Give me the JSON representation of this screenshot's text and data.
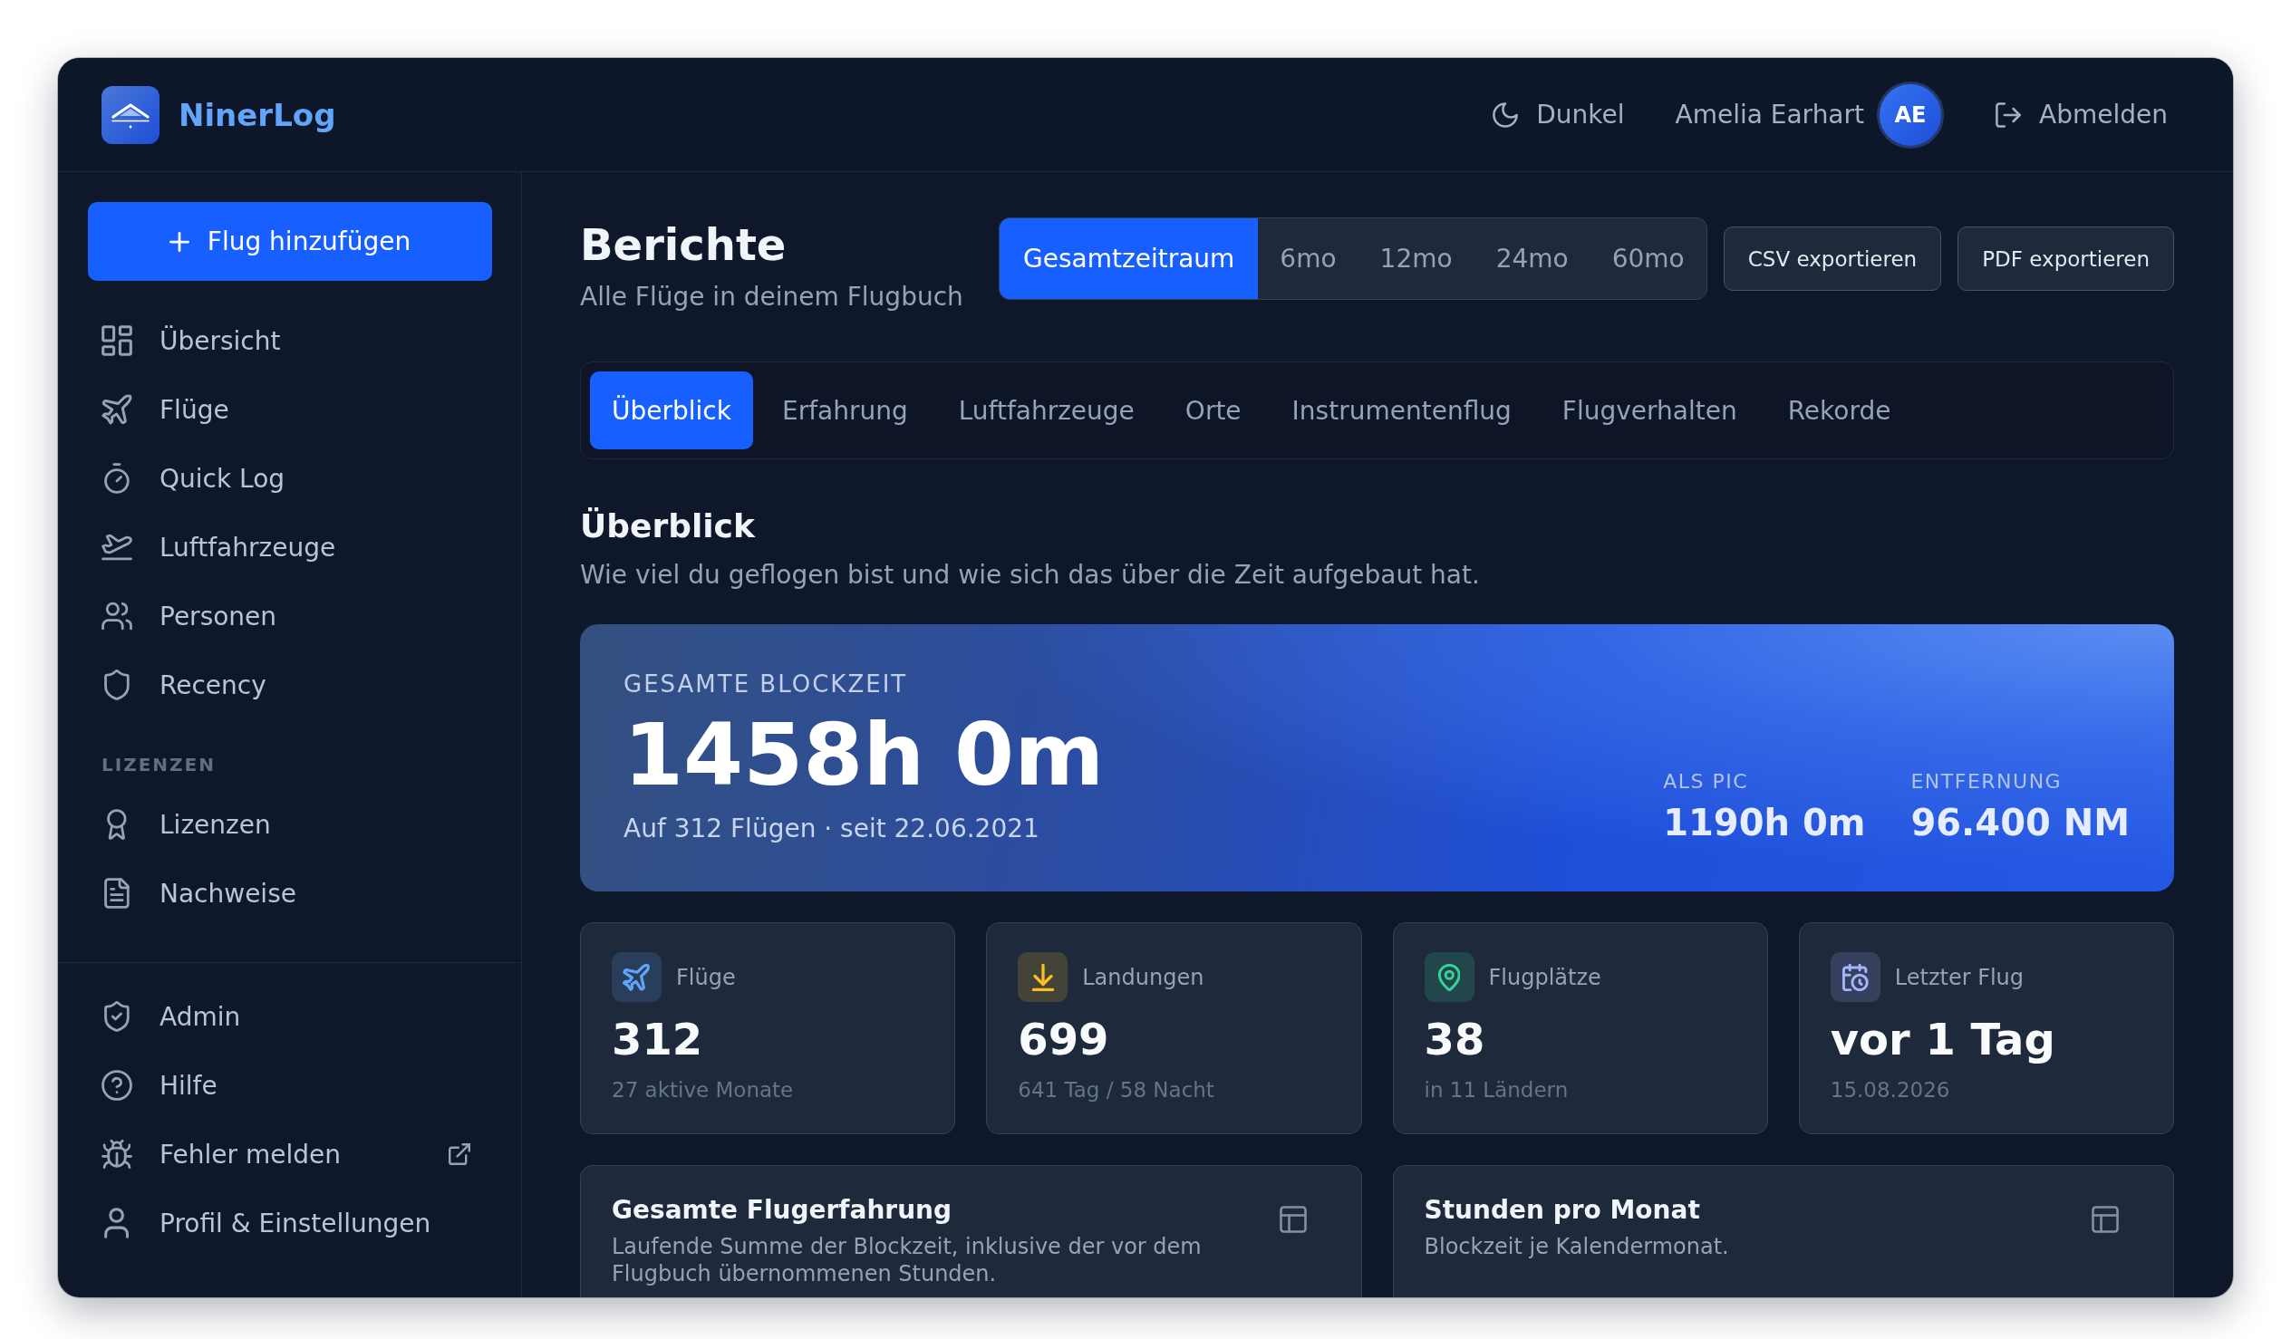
{
  "app": {
    "name": "NinerLog"
  },
  "header": {
    "theme_toggle": "Dunkel",
    "user_name": "Amelia Earhart",
    "user_initials": "AE",
    "logout": "Abmelden"
  },
  "sidebar": {
    "add_button": "Flug hinzufügen",
    "items": [
      {
        "kind": "overview",
        "label": "Übersicht",
        "external": false
      },
      {
        "kind": "flights",
        "label": "Flüge",
        "external": false
      },
      {
        "kind": "quicklog",
        "label": "Quick Log",
        "external": false
      },
      {
        "kind": "aircraft",
        "label": "Luftfahrzeuge",
        "external": false
      },
      {
        "kind": "people",
        "label": "Personen",
        "external": false
      },
      {
        "kind": "recency",
        "label": "Recency",
        "external": false
      }
    ],
    "sections": [
      {
        "heading": "LIZENZEN",
        "items": [
          {
            "kind": "licenses",
            "label": "Lizenzen",
            "external": false
          },
          {
            "kind": "documents",
            "label": "Nachweise",
            "external": false
          }
        ]
      }
    ],
    "footer_items": [
      {
        "kind": "admin",
        "label": "Admin",
        "external": false
      },
      {
        "kind": "help",
        "label": "Hilfe",
        "external": false
      },
      {
        "kind": "bug",
        "label": "Fehler melden",
        "external": true
      },
      {
        "kind": "profile",
        "label": "Profil & Einstellungen",
        "external": false
      }
    ]
  },
  "page": {
    "title": "Berichte",
    "subtitle": "Alle Flüge in deinem Flugbuch",
    "ranges": [
      {
        "label": "Gesamtzeitraum",
        "selected": true
      },
      {
        "label": "6mo",
        "selected": false
      },
      {
        "label": "12mo",
        "selected": false
      },
      {
        "label": "24mo",
        "selected": false
      },
      {
        "label": "60mo",
        "selected": false
      }
    ],
    "export_buttons": [
      "CSV exportieren",
      "PDF exportieren"
    ]
  },
  "tabs": [
    {
      "label": "Überblick",
      "selected": true
    },
    {
      "label": "Erfahrung",
      "selected": false
    },
    {
      "label": "Luftfahrzeuge",
      "selected": false
    },
    {
      "label": "Orte",
      "selected": false
    },
    {
      "label": "Instrumentenflug",
      "selected": false
    },
    {
      "label": "Flugverhalten",
      "selected": false
    },
    {
      "label": "Rekorde",
      "selected": false
    }
  ],
  "section": {
    "title": "Überblick",
    "description": "Wie viel du geflogen bist und wie sich das über die Zeit aufgebaut hat."
  },
  "hero": {
    "label": "GESAMTE BLOCKZEIT",
    "value": "1458h 0m",
    "detail": "Auf 312 Flügen · seit 22.06.2021",
    "side_stats": [
      {
        "label": "ALS PIC",
        "value": "1190h 0m"
      },
      {
        "label": "ENTFERNUNG",
        "value": "96.400 NM"
      }
    ]
  },
  "stats": [
    {
      "kind": "flights",
      "color": "#60a5fa",
      "label": "Flüge",
      "value": "312",
      "detail": "27 aktive Monate"
    },
    {
      "kind": "landings",
      "color": "#fbbf24",
      "label": "Landungen",
      "value": "699",
      "detail": "641 Tag / 58 Nacht"
    },
    {
      "kind": "airports",
      "color": "#34d399",
      "label": "Flugplätze",
      "value": "38",
      "detail": "in 11 Ländern"
    },
    {
      "kind": "lastflight",
      "color": "#a5b4fc",
      "label": "Letzter Flug",
      "value": "vor 1 Tag",
      "detail": "15.08.2026"
    }
  ],
  "chart_cards": [
    {
      "title": "Gesamte Flugerfahrung",
      "description": "Laufende Summe der Blockzeit, inklusive der vor dem Flugbuch übernommenen Stunden."
    },
    {
      "title": "Stunden pro Monat",
      "description": "Blockzeit je Kalendermonat."
    }
  ]
}
